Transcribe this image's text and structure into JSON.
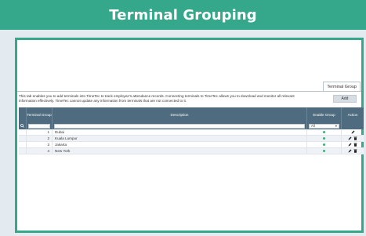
{
  "banner": {
    "title": "Terminal Grouping"
  },
  "tabs": [
    {
      "label": "Terminal Group"
    }
  ],
  "intro_text": "This tab enables you to add terminals into TimeTec to track employee's attendance records. Connecting terminals to TimeTec allows you to download and monitor all relevant information effectively. TimeTec cannot update any information from terminals that are not connected to it.",
  "add_button": "Add",
  "table": {
    "columns": {
      "group": "Terminal Group",
      "description": "Description",
      "enable": "Enable Group",
      "action": "Action"
    },
    "filter": {
      "enable_select": "All"
    },
    "rows": [
      {
        "group": "1",
        "description": "Dubai",
        "enabled": true,
        "deletable": false
      },
      {
        "group": "2",
        "description": "Kuala Lumpur",
        "enabled": true,
        "deletable": true
      },
      {
        "group": "3",
        "description": "Jakarta",
        "enabled": true,
        "deletable": true
      },
      {
        "group": "4",
        "description": "New York",
        "enabled": true,
        "deletable": true
      }
    ]
  },
  "colors": {
    "banner": "#35a88c",
    "table_header": "#4f6b7f",
    "enabled_dot": "#35b572"
  }
}
